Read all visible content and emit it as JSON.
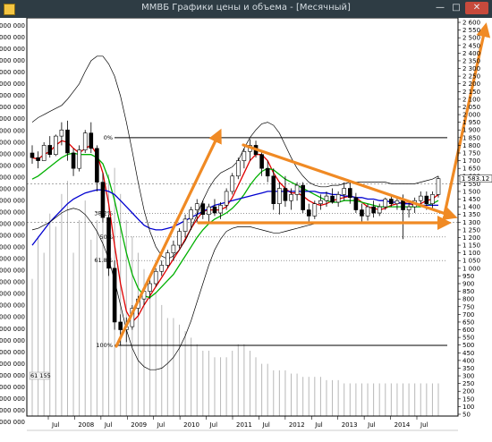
{
  "window": {
    "title": "ММВБ Графики цены и объема - [Месячный]",
    "minimize_glyph": "—",
    "maximize_glyph": "□",
    "close_glyph": "✕"
  },
  "chart_data": {
    "type": "candlestick",
    "title": "",
    "price_axis": {
      "side": "right",
      "min": 50,
      "max": 2600,
      "step": 50,
      "ticks": [
        "2 600",
        "2 550",
        "2 500",
        "2 450",
        "2 400",
        "2 350",
        "2 300",
        "2 250",
        "2 200",
        "2 150",
        "2 100",
        "2 050",
        "2 000",
        "1 950",
        "1 900",
        "1 850",
        "1 800",
        "1 750",
        "1 700",
        "1 650",
        "1 600",
        "1 550",
        "1 500",
        "1 450",
        "1 400",
        "1 350",
        "1 300",
        "1 250",
        "1 200",
        "1 150",
        "1 100",
        "1 050",
        "1 000",
        "950",
        "900",
        "850",
        "800",
        "750",
        "700",
        "650",
        "600",
        "550",
        "500",
        "450",
        "400",
        "350",
        "300",
        "250",
        "200",
        "150",
        "100",
        "50"
      ],
      "last_price": "1 583.12"
    },
    "volume_axis": {
      "side": "left",
      "ticks": [
        "000 000",
        "000 000",
        "000 000",
        "000 000",
        "000 000",
        "000 000",
        "000 000",
        "000 000",
        "000 000",
        "000 000",
        "000 000",
        "000 000",
        "000 000",
        "000 000",
        "000 000",
        "000 000",
        "000 000",
        "000 000",
        "000 000",
        "000 000",
        "000 000",
        "000 000",
        "000 000",
        "000 000",
        "000 000",
        "000 000",
        "000 000",
        "000 000",
        "000 000",
        "000 000",
        "000 000",
        "000 000",
        "000 000",
        "000 000",
        "000 000"
      ],
      "bottom_label": "61 155"
    },
    "x_axis": {
      "labels": [
        "Jul",
        "2008",
        "Jul",
        "2009",
        "Jul",
        "2010",
        "Jul",
        "2011",
        "Jul",
        "2012",
        "Jul",
        "2013",
        "Jul",
        "2014",
        "Jul"
      ]
    },
    "fibonacci": [
      {
        "label": "0%",
        "price": 1850
      },
      {
        "label": "38.2%",
        "price": 1356
      },
      {
        "label": "50%",
        "price": 1204
      },
      {
        "label": "61.8%",
        "price": 1050
      },
      {
        "label": "100%",
        "price": 498
      }
    ],
    "candles": [
      {
        "o": 1750,
        "h": 1800,
        "l": 1680,
        "c": 1720
      },
      {
        "o": 1720,
        "h": 1760,
        "l": 1650,
        "c": 1700
      },
      {
        "o": 1700,
        "h": 1820,
        "l": 1700,
        "c": 1800
      },
      {
        "o": 1800,
        "h": 1860,
        "l": 1720,
        "c": 1740
      },
      {
        "o": 1740,
        "h": 1870,
        "l": 1730,
        "c": 1860
      },
      {
        "o": 1860,
        "h": 1950,
        "l": 1800,
        "c": 1900
      },
      {
        "o": 1900,
        "h": 1960,
        "l": 1700,
        "c": 1750
      },
      {
        "o": 1750,
        "h": 1780,
        "l": 1600,
        "c": 1650
      },
      {
        "o": 1650,
        "h": 1800,
        "l": 1630,
        "c": 1770
      },
      {
        "o": 1770,
        "h": 1900,
        "l": 1750,
        "c": 1880
      },
      {
        "o": 1880,
        "h": 1950,
        "l": 1750,
        "c": 1780
      },
      {
        "o": 1780,
        "h": 1800,
        "l": 1500,
        "c": 1560
      },
      {
        "o": 1560,
        "h": 1620,
        "l": 1300,
        "c": 1330
      },
      {
        "o": 1330,
        "h": 1350,
        "l": 950,
        "c": 1000
      },
      {
        "o": 1000,
        "h": 1050,
        "l": 600,
        "c": 650
      },
      {
        "o": 650,
        "h": 700,
        "l": 500,
        "c": 600
      },
      {
        "o": 600,
        "h": 680,
        "l": 520,
        "c": 620
      },
      {
        "o": 620,
        "h": 760,
        "l": 600,
        "c": 740
      },
      {
        "o": 740,
        "h": 820,
        "l": 700,
        "c": 800
      },
      {
        "o": 800,
        "h": 880,
        "l": 760,
        "c": 850
      },
      {
        "o": 850,
        "h": 920,
        "l": 800,
        "c": 900
      },
      {
        "o": 900,
        "h": 1000,
        "l": 880,
        "c": 980
      },
      {
        "o": 980,
        "h": 1050,
        "l": 950,
        "c": 1020
      },
      {
        "o": 1020,
        "h": 1120,
        "l": 1000,
        "c": 1100
      },
      {
        "o": 1100,
        "h": 1180,
        "l": 1050,
        "c": 1150
      },
      {
        "o": 1150,
        "h": 1260,
        "l": 1130,
        "c": 1240
      },
      {
        "o": 1240,
        "h": 1350,
        "l": 1200,
        "c": 1320
      },
      {
        "o": 1320,
        "h": 1400,
        "l": 1250,
        "c": 1380
      },
      {
        "o": 1380,
        "h": 1450,
        "l": 1300,
        "c": 1420
      },
      {
        "o": 1420,
        "h": 1440,
        "l": 1320,
        "c": 1350
      },
      {
        "o": 1350,
        "h": 1420,
        "l": 1300,
        "c": 1400
      },
      {
        "o": 1400,
        "h": 1450,
        "l": 1340,
        "c": 1360
      },
      {
        "o": 1360,
        "h": 1430,
        "l": 1320,
        "c": 1410
      },
      {
        "o": 1410,
        "h": 1520,
        "l": 1380,
        "c": 1500
      },
      {
        "o": 1500,
        "h": 1620,
        "l": 1480,
        "c": 1600
      },
      {
        "o": 1600,
        "h": 1720,
        "l": 1580,
        "c": 1700
      },
      {
        "o": 1700,
        "h": 1780,
        "l": 1650,
        "c": 1760
      },
      {
        "o": 1760,
        "h": 1840,
        "l": 1700,
        "c": 1800
      },
      {
        "o": 1800,
        "h": 1830,
        "l": 1720,
        "c": 1740
      },
      {
        "o": 1740,
        "h": 1760,
        "l": 1600,
        "c": 1650
      },
      {
        "o": 1650,
        "h": 1700,
        "l": 1560,
        "c": 1600
      },
      {
        "o": 1600,
        "h": 1650,
        "l": 1380,
        "c": 1420
      },
      {
        "o": 1420,
        "h": 1560,
        "l": 1350,
        "c": 1520
      },
      {
        "o": 1520,
        "h": 1600,
        "l": 1400,
        "c": 1440
      },
      {
        "o": 1440,
        "h": 1520,
        "l": 1380,
        "c": 1480
      },
      {
        "o": 1480,
        "h": 1560,
        "l": 1440,
        "c": 1540
      },
      {
        "o": 1540,
        "h": 1560,
        "l": 1360,
        "c": 1380
      },
      {
        "o": 1380,
        "h": 1420,
        "l": 1300,
        "c": 1340
      },
      {
        "o": 1340,
        "h": 1440,
        "l": 1320,
        "c": 1420
      },
      {
        "o": 1420,
        "h": 1480,
        "l": 1380,
        "c": 1440
      },
      {
        "o": 1440,
        "h": 1500,
        "l": 1400,
        "c": 1470
      },
      {
        "o": 1470,
        "h": 1520,
        "l": 1420,
        "c": 1430
      },
      {
        "o": 1430,
        "h": 1500,
        "l": 1400,
        "c": 1480
      },
      {
        "o": 1480,
        "h": 1560,
        "l": 1440,
        "c": 1520
      },
      {
        "o": 1520,
        "h": 1560,
        "l": 1420,
        "c": 1460
      },
      {
        "o": 1460,
        "h": 1490,
        "l": 1360,
        "c": 1380
      },
      {
        "o": 1380,
        "h": 1420,
        "l": 1300,
        "c": 1340
      },
      {
        "o": 1340,
        "h": 1420,
        "l": 1310,
        "c": 1400
      },
      {
        "o": 1400,
        "h": 1440,
        "l": 1330,
        "c": 1360
      },
      {
        "o": 1360,
        "h": 1420,
        "l": 1340,
        "c": 1400
      },
      {
        "o": 1400,
        "h": 1460,
        "l": 1380,
        "c": 1450
      },
      {
        "o": 1450,
        "h": 1480,
        "l": 1400,
        "c": 1420
      },
      {
        "o": 1420,
        "h": 1460,
        "l": 1380,
        "c": 1440
      },
      {
        "o": 1440,
        "h": 1480,
        "l": 1190,
        "c": 1380
      },
      {
        "o": 1380,
        "h": 1440,
        "l": 1330,
        "c": 1400
      },
      {
        "o": 1400,
        "h": 1460,
        "l": 1360,
        "c": 1440
      },
      {
        "o": 1440,
        "h": 1500,
        "l": 1400,
        "c": 1470
      },
      {
        "o": 1470,
        "h": 1500,
        "l": 1380,
        "c": 1420
      },
      {
        "o": 1420,
        "h": 1500,
        "l": 1390,
        "c": 1480
      },
      {
        "o": 1480,
        "h": 1600,
        "l": 1460,
        "c": 1583
      }
    ],
    "series": [
      {
        "name": "",
        "color": "#e00000",
        "values": [
          1720,
          1710,
          1740,
          1760,
          1800,
          1830,
          1820,
          1780,
          1750,
          1780,
          1800,
          1740,
          1620,
          1420,
          1150,
          900,
          720,
          650,
          690,
          760,
          820,
          880,
          940,
          1000,
          1060,
          1120,
          1190,
          1260,
          1320,
          1370,
          1380,
          1380,
          1380,
          1400,
          1460,
          1540,
          1620,
          1700,
          1740,
          1740,
          1700,
          1620,
          1560,
          1520,
          1490,
          1490,
          1470,
          1440,
          1420,
          1410,
          1420,
          1440,
          1450,
          1460,
          1470,
          1460,
          1430,
          1400,
          1390,
          1380,
          1390,
          1410,
          1420,
          1430,
          1420,
          1410,
          1420,
          1440,
          1450,
          1480
        ]
      },
      {
        "name": "",
        "color": "#00b000",
        "values": [
          1580,
          1600,
          1630,
          1660,
          1690,
          1720,
          1740,
          1750,
          1740,
          1740,
          1740,
          1720,
          1680,
          1580,
          1440,
          1270,
          1100,
          960,
          870,
          820,
          810,
          840,
          880,
          920,
          960,
          1020,
          1080,
          1140,
          1200,
          1250,
          1290,
          1320,
          1340,
          1360,
          1390,
          1430,
          1480,
          1540,
          1590,
          1630,
          1650,
          1640,
          1610,
          1580,
          1560,
          1540,
          1520,
          1500,
          1480,
          1460,
          1440,
          1430,
          1430,
          1440,
          1440,
          1440,
          1430,
          1420,
          1410,
          1400,
          1400,
          1400,
          1400,
          1400,
          1400,
          1400,
          1400,
          1410,
          1420,
          1440
        ]
      },
      {
        "name": "",
        "color": "#0000d0",
        "values": [
          1150,
          1200,
          1250,
          1300,
          1340,
          1380,
          1420,
          1450,
          1470,
          1490,
          1500,
          1510,
          1510,
          1500,
          1480,
          1440,
          1400,
          1360,
          1320,
          1280,
          1260,
          1250,
          1250,
          1260,
          1270,
          1290,
          1310,
          1330,
          1350,
          1370,
          1390,
          1410,
          1420,
          1430,
          1440,
          1450,
          1460,
          1470,
          1480,
          1490,
          1500,
          1500,
          1500,
          1500,
          1500,
          1500,
          1500,
          1500,
          1500,
          1490,
          1490,
          1480,
          1480,
          1470,
          1470,
          1460,
          1460,
          1450,
          1450,
          1440,
          1440,
          1430,
          1430,
          1420,
          1420,
          1420,
          1410,
          1410,
          1410,
          1410
        ]
      },
      {
        "name": "",
        "color": "#000000",
        "values": [
          1950,
          1980,
          2000,
          2020,
          2040,
          2060,
          2100,
          2150,
          2200,
          2280,
          2350,
          2380,
          2380,
          2330,
          2250,
          2120,
          1950,
          1760,
          1560,
          1380,
          1240,
          1140,
          1080,
          1060,
          1080,
          1120,
          1180,
          1260,
          1350,
          1440,
          1520,
          1580,
          1620,
          1640,
          1660,
          1700,
          1780,
          1850,
          1900,
          1940,
          1950,
          1930,
          1880,
          1800,
          1720,
          1650,
          1600,
          1560,
          1540,
          1530,
          1530,
          1540,
          1540,
          1550,
          1560,
          1560,
          1560,
          1560,
          1560,
          1560,
          1560,
          1550,
          1550,
          1550,
          1550,
          1550,
          1560,
          1570,
          1580,
          1600
        ]
      },
      {
        "name": "",
        "color": "#000000",
        "values": [
          1250,
          1260,
          1280,
          1300,
          1330,
          1360,
          1380,
          1390,
          1380,
          1350,
          1300,
          1240,
          1160,
          1060,
          920,
          760,
          600,
          480,
          400,
          360,
          340,
          340,
          350,
          380,
          420,
          480,
          560,
          660,
          780,
          900,
          1020,
          1120,
          1190,
          1240,
          1260,
          1270,
          1270,
          1270,
          1260,
          1250,
          1240,
          1230,
          1230,
          1240,
          1250,
          1260,
          1270,
          1280,
          1290,
          1300,
          1300,
          1300,
          1300,
          1300,
          1300,
          1300,
          1300,
          1300,
          1300,
          1300,
          1300,
          1300,
          1300,
          1300,
          1300,
          1300,
          1300,
          1300,
          1300,
          1300
        ]
      }
    ],
    "volume": [
      0.42,
      0.55,
      0.5,
      0.62,
      0.58,
      0.68,
      0.72,
      0.5,
      0.6,
      0.66,
      0.54,
      0.6,
      0.7,
      0.74,
      0.76,
      0.68,
      0.6,
      0.55,
      0.5,
      0.45,
      0.42,
      0.38,
      0.34,
      0.3,
      0.3,
      0.28,
      0.26,
      0.24,
      0.22,
      0.2,
      0.2,
      0.18,
      0.18,
      0.18,
      0.2,
      0.22,
      0.22,
      0.2,
      0.18,
      0.16,
      0.16,
      0.14,
      0.14,
      0.14,
      0.13,
      0.13,
      0.12,
      0.12,
      0.12,
      0.12,
      0.11,
      0.11,
      0.11,
      0.1,
      0.1,
      0.1,
      0.1,
      0.1,
      0.1,
      0.1,
      0.1,
      0.1,
      0.1,
      0.1,
      0.1,
      0.1,
      0.1,
      0.1,
      0.1,
      0.1
    ]
  }
}
